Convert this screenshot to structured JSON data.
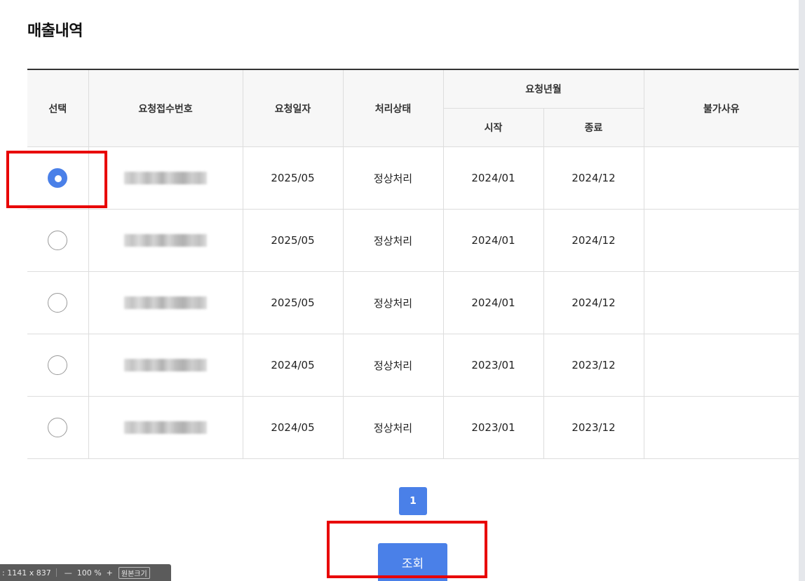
{
  "page_title": "매출내역",
  "table": {
    "headers": {
      "select": "선택",
      "request_no": "요청접수번호",
      "request_date": "요청일자",
      "status": "처리상태",
      "request_period": "요청년월",
      "period_start": "시작",
      "period_end": "종료",
      "reject_reason": "불가사유"
    },
    "rows": [
      {
        "selected": true,
        "request_date": "2025/05",
        "status": "정상처리",
        "start": "2024/01",
        "end": "2024/12",
        "reason": ""
      },
      {
        "selected": false,
        "request_date": "2025/05",
        "status": "정상처리",
        "start": "2024/01",
        "end": "2024/12",
        "reason": ""
      },
      {
        "selected": false,
        "request_date": "2025/05",
        "status": "정상처리",
        "start": "2024/01",
        "end": "2024/12",
        "reason": ""
      },
      {
        "selected": false,
        "request_date": "2024/05",
        "status": "정상처리",
        "start": "2023/01",
        "end": "2023/12",
        "reason": ""
      },
      {
        "selected": false,
        "request_date": "2024/05",
        "status": "정상처리",
        "start": "2023/01",
        "end": "2023/12",
        "reason": ""
      }
    ]
  },
  "pagination": {
    "current_page": "1"
  },
  "search_button_label": "조회",
  "viewer_bar": {
    "size_text": ": 1141 x 837",
    "minus": "—",
    "zoom": "100 %",
    "plus": "+",
    "original_size": "원본크기"
  },
  "colors": {
    "accent": "#4a80e8",
    "highlight": "#e80000",
    "header_bg": "#f7f7f7"
  }
}
